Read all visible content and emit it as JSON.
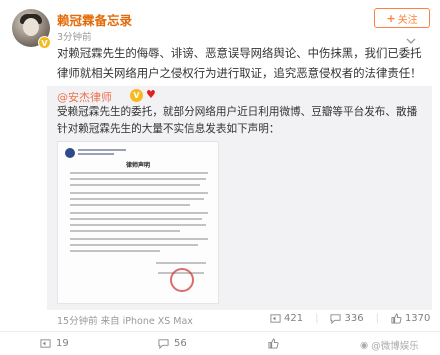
{
  "post": {
    "author": "赖冠霖备忘录",
    "time": "3分钟前",
    "follow_label": "关注",
    "text": "对赖冠霖先生的侮辱、诽谤、恶意误导网络舆论、中伤抹黑，我们已委托律师就相关网络用户之侵权行为进行取证，追究恶意侵权者的法律责任！",
    "source": "15分钟前 来自 iPhone XS Max",
    "repost_count": "421",
    "comment_count": "336",
    "like_count": "1370"
  },
  "repost": {
    "author": "@安杰律师",
    "text": "受赖冠霖先生的委托，就部分网络用户近日利用微博、豆瓣等平台发布、散播针对赖冠霖先生的大量不实信息发表如下声明：",
    "doc_title": "律师声明"
  },
  "bottom_bar": {
    "repost_count": "19",
    "comment_count": "56"
  },
  "watermark": "@微博娱乐",
  "colors": {
    "author_orange": "#e46b09",
    "follow_orange": "#ff8140",
    "repost_bg": "#f2f2f5",
    "mention_orange": "#eb7350"
  }
}
